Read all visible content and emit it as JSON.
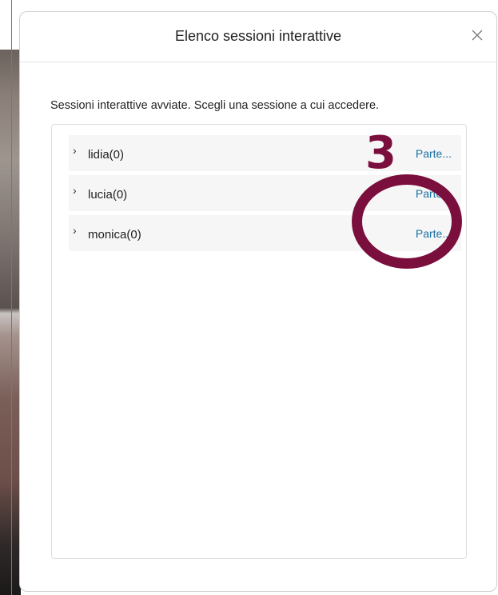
{
  "dialog": {
    "title": "Elenco sessioni interattive",
    "close_icon": "close-icon",
    "instructions": "Sessioni interattive avviate. Scegli una sessione a cui accedere."
  },
  "sessions": [
    {
      "name": "lidia(0)",
      "join_label": "Parte..."
    },
    {
      "name": "lucia(0)",
      "join_label": "Parte..."
    },
    {
      "name": "monica(0)",
      "join_label": "Parte..."
    }
  ],
  "annotation": {
    "step_number": "3",
    "color": "#7a0e3c"
  },
  "colors": {
    "link": "#1a6fa3",
    "row_background": "#f6f6f6"
  }
}
